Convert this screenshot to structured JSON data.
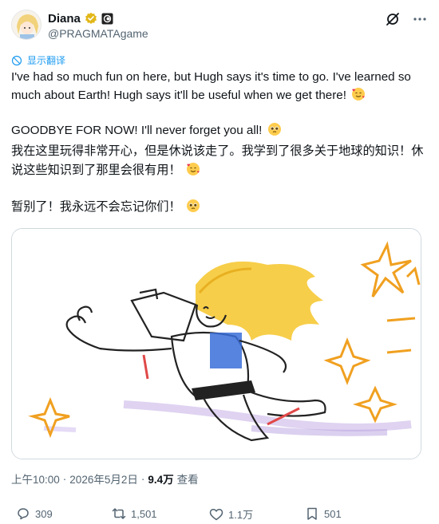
{
  "author": {
    "display_name": "Diana",
    "handle": "@PRAGMATAgame",
    "avatar_icon": "anime-girl-avatar",
    "verified_icon": "gold-verified-badge",
    "affiliation_icon": "affiliate-badge"
  },
  "header_actions": {
    "grok_icon": "grok-icon",
    "more_icon": "more-horizontal-icon"
  },
  "translate": {
    "label": "显示翻译",
    "icon": "translate-globe-icon"
  },
  "tweet": {
    "en_para1": "I've had so much fun on here, but Hugh says it's time to go. I've learned so much about Earth! Hugh says it'll be useful when we get there!",
    "en_para2": "GOODBYE FOR NOW! I'll never forget you all!",
    "cn_para1": "我在这里玩得非常开心，但是休说该走了。我学到了很多关于地球的知识！休说这些知识到了那里会很有用！",
    "cn_para2": "暂别了！我永远不会忘记你们！",
    "emoji_love": "smiling-face-with-hearts",
    "emoji_tear": "pleading-face"
  },
  "media": {
    "description_icon": "crayon-drawing-running-girl"
  },
  "meta": {
    "time": "上午10:00",
    "separator": "·",
    "date": "2026年5月2日",
    "views": "9.4万",
    "views_label": "查看"
  },
  "stats": {
    "replies": "309",
    "reposts": "1,501",
    "likes": "1.1万",
    "bookmarks": "501"
  },
  "colors": {
    "accent": "#1d9bf0",
    "text": "#0f1419",
    "muted": "#536471",
    "border": "#cfd9de"
  }
}
